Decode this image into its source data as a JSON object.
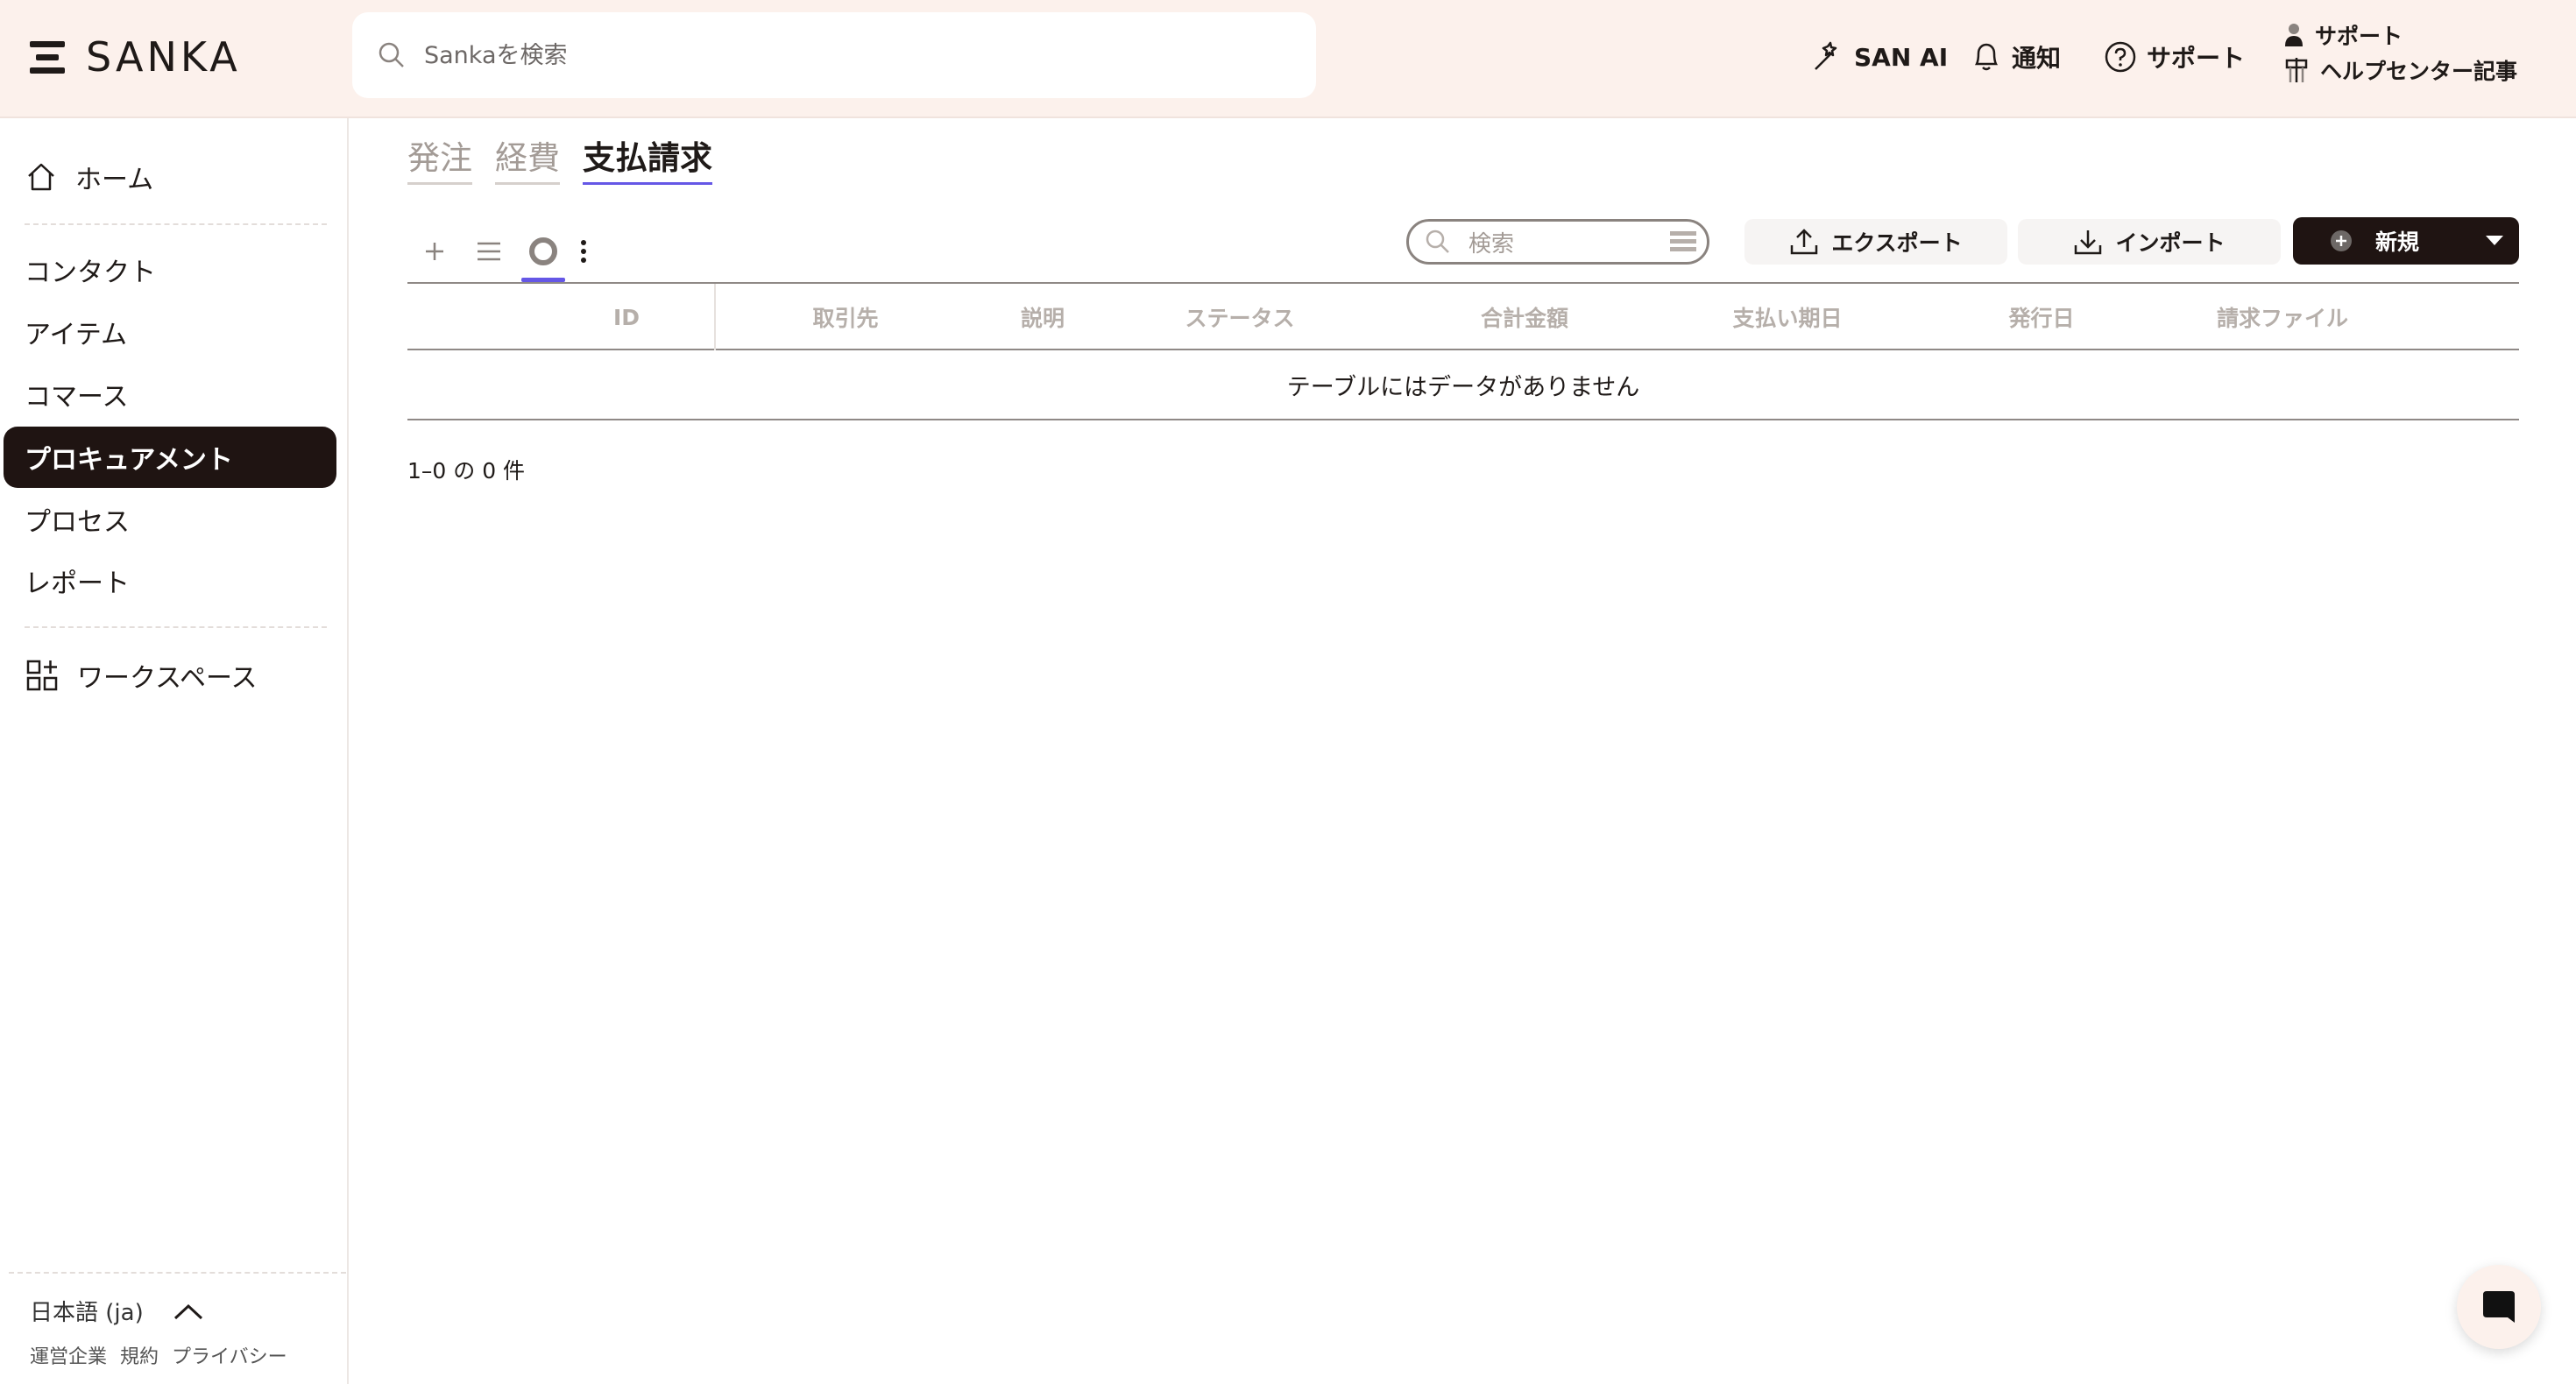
{
  "header": {
    "logo_text": "SANKA",
    "search_placeholder": "Sankaを検索",
    "san_ai_label": "SAN AI",
    "notifications_label": "通知",
    "support_label": "サポート",
    "support_stack": {
      "support_label": "サポート",
      "help_center_label": "ヘルプセンター記事"
    }
  },
  "sidebar": {
    "items": [
      {
        "label": "ホーム",
        "icon": "home-icon"
      },
      {
        "label": "コンタクト"
      },
      {
        "label": "アイテム"
      },
      {
        "label": "コマース"
      },
      {
        "label": "プロキュアメント",
        "active": true
      },
      {
        "label": "プロセス"
      },
      {
        "label": "レポート"
      },
      {
        "label": "ワークスペース",
        "icon": "apps-icon"
      }
    ],
    "language": "日本語 (ja)",
    "footer_links": [
      "運営企業",
      "規約",
      "プライバシー"
    ]
  },
  "main": {
    "tabs": [
      {
        "label": "発注",
        "active": false
      },
      {
        "label": "経費",
        "active": false
      },
      {
        "label": "支払請求",
        "active": true
      }
    ],
    "table_search_placeholder": "検索",
    "export_label": "エクスポート",
    "import_label": "インポート",
    "new_label": "新規",
    "columns": [
      "ID",
      "取引先",
      "説明",
      "ステータス",
      "合計金額",
      "支払い期日",
      "発行日",
      "請求ファイル"
    ],
    "empty_message": "テーブルにはデータがありません",
    "pagination": "1–0 の 0 件"
  },
  "colors": {
    "header_bg": "#fcf1ec",
    "active_nav_bg": "#1f1412",
    "accent": "#6557e6"
  }
}
